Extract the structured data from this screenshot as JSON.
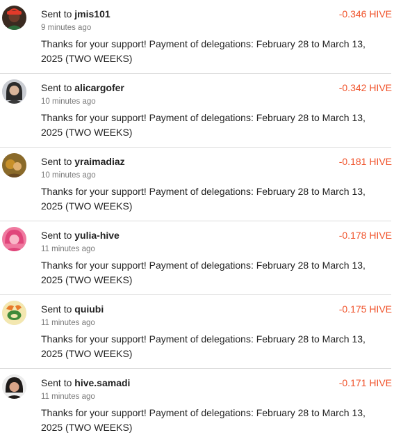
{
  "transfers": [
    {
      "sent_prefix": "Sent to",
      "username": "jmis101",
      "amount": "-0.346 HIVE",
      "time_ago": "9 minutes ago",
      "memo": "Thanks for your support! Payment of delegations: February 28 to March 13, 2025 (TWO WEEKS)",
      "avatar_colors": {
        "bg": "#3a2a20",
        "face": "#6b3b2a",
        "accent": "#e23a2a"
      }
    },
    {
      "sent_prefix": "Sent to",
      "username": "alicargofer",
      "amount": "-0.342 HIVE",
      "time_ago": "10 minutes ago",
      "memo": "Thanks for your support! Payment of delegations: February 28 to March 13, 2025 (TWO WEEKS)",
      "avatar_colors": {
        "bg": "#c9ccd2",
        "face": "#d8b49a",
        "accent": "#2b2b2b"
      }
    },
    {
      "sent_prefix": "Sent to",
      "username": "yraimadiaz",
      "amount": "-0.181 HIVE",
      "time_ago": "10 minutes ago",
      "memo": "Thanks for your support! Payment of delegations: February 28 to March 13, 2025 (TWO WEEKS)",
      "avatar_colors": {
        "bg": "#8a6a2a",
        "face": "#e0b070",
        "accent": "#c8902a"
      }
    },
    {
      "sent_prefix": "Sent to",
      "username": "yulia-hive",
      "amount": "-0.178 HIVE",
      "time_ago": "11 minutes ago",
      "memo": "Thanks for your support! Payment of delegations: February 28 to March 13, 2025 (TWO WEEKS)",
      "avatar_colors": {
        "bg": "#f07aa0",
        "face": "#f9b8c8",
        "accent": "#e0457a"
      }
    },
    {
      "sent_prefix": "Sent to",
      "username": "quiubi",
      "amount": "-0.175 HIVE",
      "time_ago": "11 minutes ago",
      "memo": "Thanks for your support! Payment of delegations: February 28 to March 13, 2025 (TWO WEEKS)",
      "avatar_colors": {
        "bg": "#f3e7b0",
        "face": "#e87a2a",
        "accent": "#3f8a3a"
      }
    },
    {
      "sent_prefix": "Sent to",
      "username": "hive.samadi",
      "amount": "-0.171 HIVE",
      "time_ago": "11 minutes ago",
      "memo": "Thanks for your support! Payment of delegations: February 28 to March 13, 2025 (TWO WEEKS)",
      "avatar_colors": {
        "bg": "#ececec",
        "face": "#d9a488",
        "accent": "#1e1a18"
      }
    }
  ]
}
